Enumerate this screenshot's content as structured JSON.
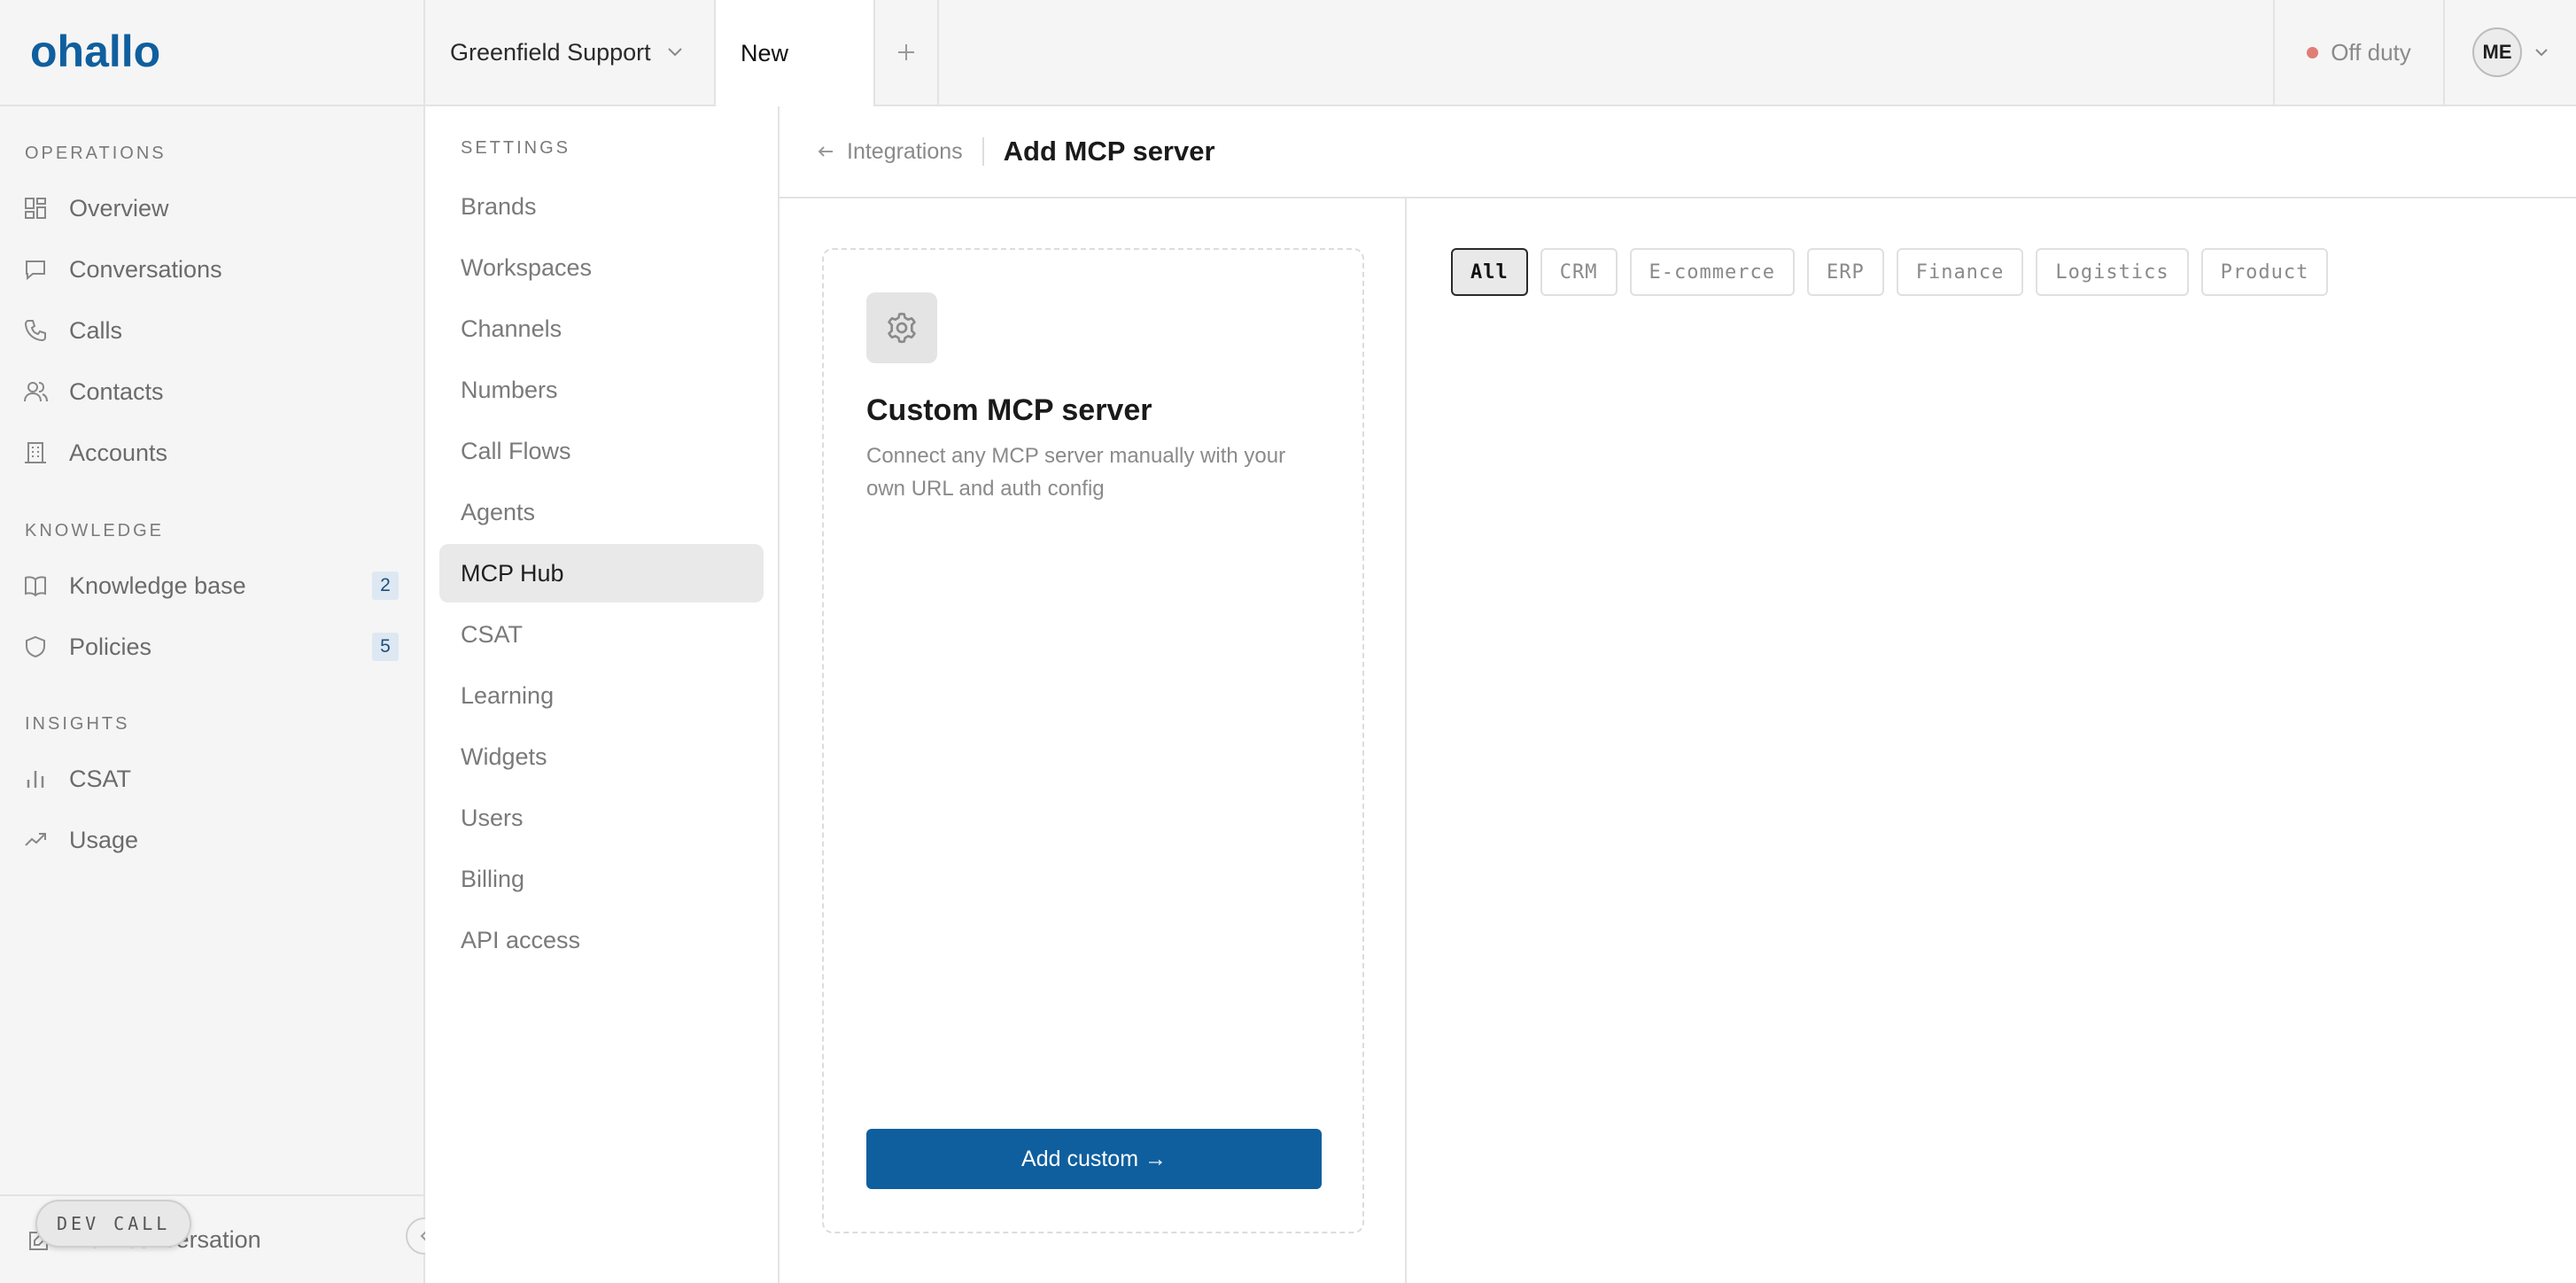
{
  "app": {
    "logo_text": "ohallo"
  },
  "header": {
    "workspace": "Greenfield Support",
    "tab_new": "New",
    "status_label": "Off duty",
    "user_initials": "ME"
  },
  "sidebar": {
    "sections": [
      {
        "title": "OPERATIONS",
        "items": [
          {
            "label": "Overview",
            "icon": "dashboard-icon"
          },
          {
            "label": "Conversations",
            "icon": "chat-bubble-icon"
          },
          {
            "label": "Calls",
            "icon": "phone-icon"
          },
          {
            "label": "Contacts",
            "icon": "users-icon"
          },
          {
            "label": "Accounts",
            "icon": "building-icon"
          }
        ]
      },
      {
        "title": "KNOWLEDGE",
        "items": [
          {
            "label": "Knowledge base",
            "icon": "book-icon",
            "badge": "2"
          },
          {
            "label": "Policies",
            "icon": "shield-icon",
            "badge": "5"
          }
        ]
      },
      {
        "title": "INSIGHTS",
        "items": [
          {
            "label": "CSAT",
            "icon": "bar-chart-icon"
          },
          {
            "label": "Usage",
            "icon": "trend-icon"
          }
        ]
      }
    ],
    "footer": {
      "new_conversation": "New conversation",
      "dev_call": "DEV CALL"
    }
  },
  "settings": {
    "title": "SETTINGS",
    "items": [
      "Brands",
      "Workspaces",
      "Channels",
      "Numbers",
      "Call Flows",
      "Agents",
      "MCP Hub",
      "CSAT",
      "Learning",
      "Widgets",
      "Users",
      "Billing",
      "API access"
    ],
    "active": "MCP Hub"
  },
  "main": {
    "breadcrumb": {
      "back_label": "Integrations",
      "title": "Add MCP server"
    },
    "custom_card": {
      "title": "Custom MCP server",
      "description": "Connect any MCP server manually with your own URL and auth config",
      "button": "Add custom →"
    },
    "filters": [
      "All",
      "CRM",
      "E-commerce",
      "ERP",
      "Finance",
      "Logistics",
      "Product"
    ],
    "active_filter": "All"
  },
  "colors": {
    "primary": "#0f5f9e",
    "status_off": "#e07d76",
    "badge_bg": "#dde8f3"
  }
}
